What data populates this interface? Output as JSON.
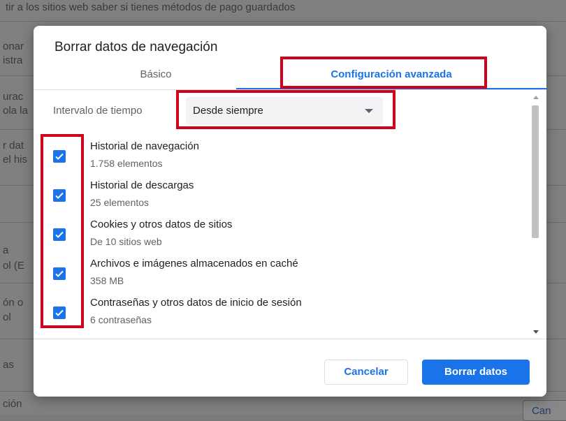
{
  "background": {
    "texts": [
      "tir a los sitios web saber si tienes métodos de pago guardados",
      "onar",
      "istra",
      "urac",
      "ola la",
      "r dat",
      "el his",
      "a",
      "ol (E",
      "ón o",
      "ol",
      "as",
      "ción"
    ],
    "partial_button": "Can"
  },
  "dialog": {
    "title": "Borrar datos de navegación",
    "tabs": [
      {
        "label": "Básico",
        "active": false
      },
      {
        "label": "Configuración avanzada",
        "active": true
      }
    ],
    "time_range": {
      "label": "Intervalo de tiempo",
      "selected": "Desde siempre"
    },
    "items": [
      {
        "title": "Historial de navegación",
        "subtitle": "1.758 elementos",
        "checked": true
      },
      {
        "title": "Historial de descargas",
        "subtitle": "25 elementos",
        "checked": true
      },
      {
        "title": "Cookies y otros datos de sitios",
        "subtitle": "De 10 sitios web",
        "checked": true
      },
      {
        "title": "Archivos e imágenes almacenados en caché",
        "subtitle": "358 MB",
        "checked": true
      },
      {
        "title": "Contraseñas y otros datos de inicio de sesión",
        "subtitle": "6 contraseñas",
        "checked": true
      }
    ],
    "buttons": {
      "cancel": "Cancelar",
      "clear": "Borrar datos"
    }
  },
  "colors": {
    "accent": "#1a73e8",
    "annotation": "#d0021b"
  }
}
